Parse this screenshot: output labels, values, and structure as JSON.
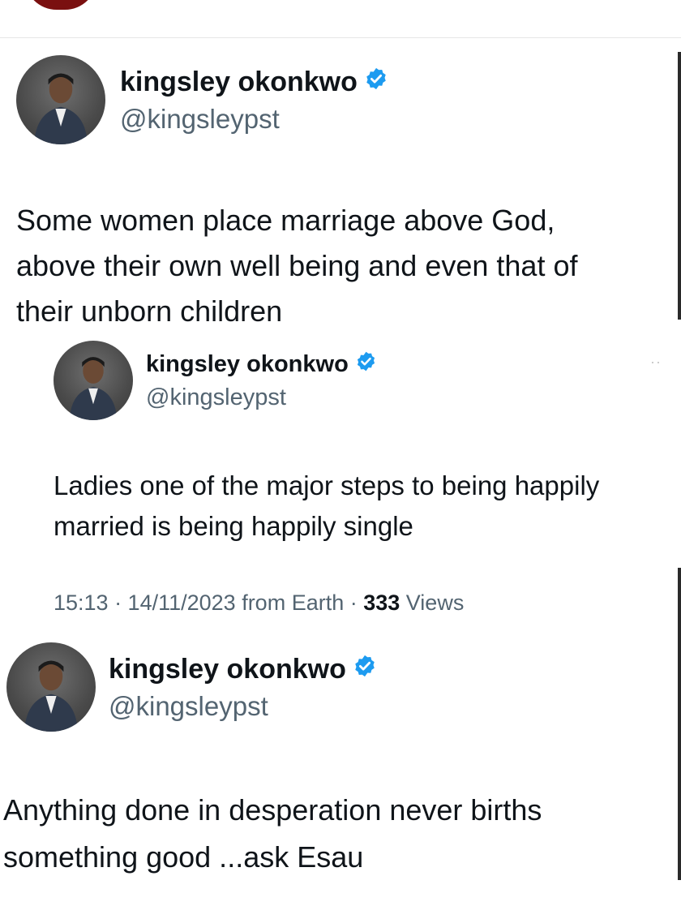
{
  "tweet1": {
    "name": "kingsley okonkwo",
    "handle": "@kingsleypst",
    "text": "Some women place marriage above God,\nabove their own well being and even that of\ntheir unborn children"
  },
  "quoted": {
    "name": "kingsley okonkwo",
    "handle": "@kingsleypst",
    "more": "··",
    "text": "Ladies one of the major steps to being happily\nmarried is being happily single",
    "meta_prefix": "15:13 · 14/11/2023 from Earth · ",
    "views_count": "333",
    "views_label": " Views"
  },
  "tweet2": {
    "name": "kingsley okonkwo",
    "handle": "@kingsleypst",
    "text": "Anything done in desperation never births\nsomething good ...ask Esau"
  },
  "colors": {
    "verified": "#1d9bf0",
    "handle": "#536471",
    "text": "#0f1419"
  },
  "icons": {
    "verified": "verified-badge-icon",
    "avatar": "profile-photo"
  }
}
